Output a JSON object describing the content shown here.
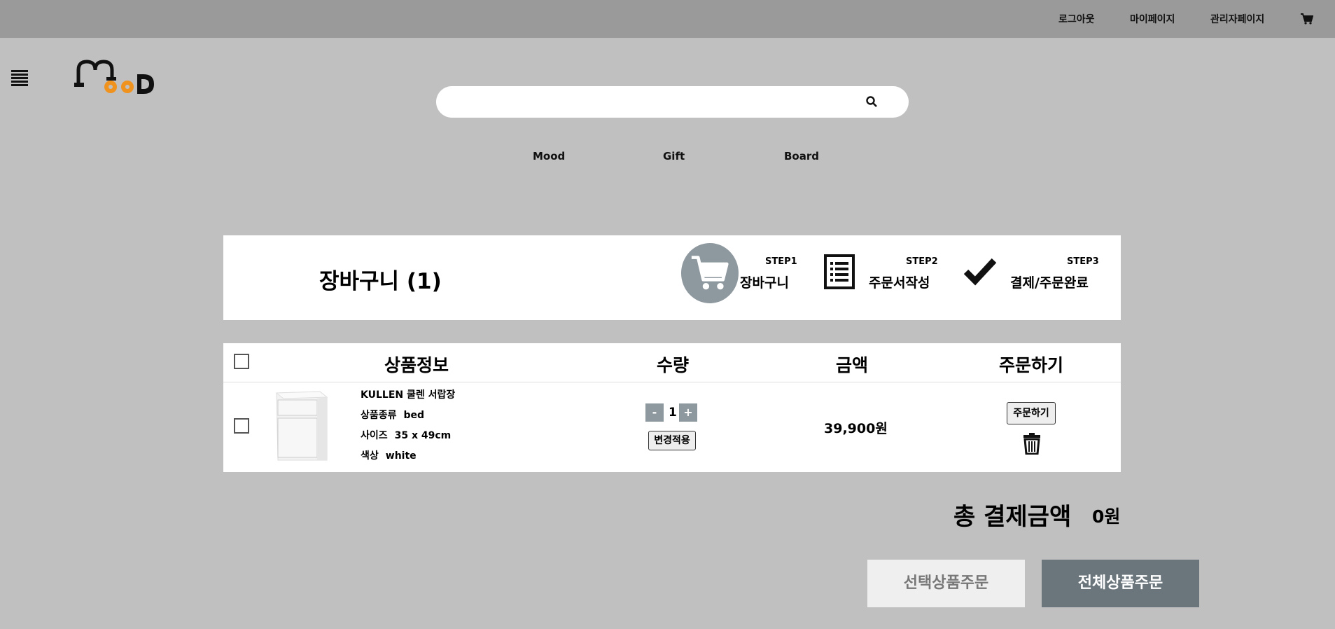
{
  "topbar": {
    "logout": "로그아웃",
    "mypage": "마이페이지",
    "admin": "관리자페이지",
    "cart_icon": "cart-icon"
  },
  "header": {
    "menu_icon": "hamburger-icon",
    "logo": "MooD",
    "search_placeholder": "",
    "search_icon": "search-icon"
  },
  "nav": [
    "Mood",
    "Gift",
    "Board"
  ],
  "cart_panel": {
    "title": "장바구니 (1)",
    "steps": [
      {
        "label": "STEP1",
        "text": "장바구니",
        "icon": "cart-icon"
      },
      {
        "label": "STEP2",
        "text": "주문서작성",
        "icon": "list-icon"
      },
      {
        "label": "STEP3",
        "text": "결제/주문완료",
        "icon": "check-icon"
      }
    ]
  },
  "table": {
    "headers": [
      "상품정보",
      "수량",
      "금액",
      "주문하기"
    ],
    "items": [
      {
        "name": "KULLEN 쿨렌 서랍장",
        "category_label": "상품종류",
        "category": "bed",
        "size_label": "사이즈",
        "size": "35 x 49cm",
        "color_label": "색상",
        "color": "white",
        "quantity": "1",
        "minus": "-",
        "plus": "+",
        "apply": "변경적용",
        "price": "39,900원",
        "order": "주문하기"
      }
    ]
  },
  "total": {
    "label": "총 결제금액",
    "value": "0원"
  },
  "buttons": {
    "order_selected": "선택상품주문",
    "order_all": "전체상품주문"
  },
  "colors": {
    "topbar": "#9a9a9a",
    "background": "#c0c0c0",
    "accent_gray": "#8e989f",
    "dark_button": "#6a757c",
    "logo_orange": "#f0921e"
  }
}
